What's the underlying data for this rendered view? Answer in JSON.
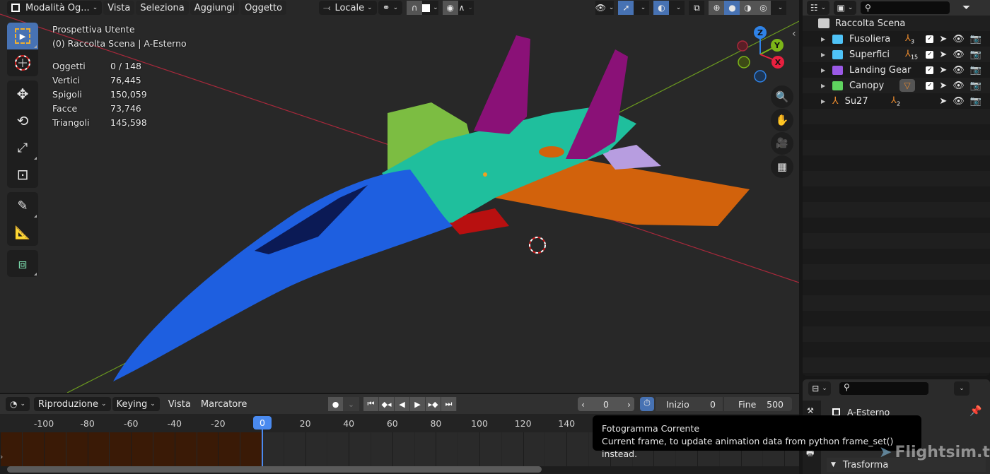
{
  "viewport_header": {
    "mode_label": "Modalità Og...",
    "menus": [
      "Vista",
      "Seleziona",
      "Aggiungi",
      "Oggetto"
    ],
    "transform_orientation": "Locale"
  },
  "overlay": {
    "view_name": "Prospettiva Utente",
    "context": "(0) Raccolta Scena | A-Esterno",
    "stats": [
      {
        "label": "Oggetti",
        "value": "0 / 148"
      },
      {
        "label": "Vertici",
        "value": "76,445"
      },
      {
        "label": "Spigoli",
        "value": "150,059"
      },
      {
        "label": "Facce",
        "value": "73,746"
      },
      {
        "label": "Triangoli",
        "value": "145,598"
      }
    ]
  },
  "gizmo": {
    "x": "X",
    "y": "Y",
    "z": "Z"
  },
  "outliner": {
    "root": "Raccolta Scena",
    "items": [
      {
        "name": "Fusoliera",
        "color": "#4fc3f7",
        "badge": "3",
        "checkbox": true
      },
      {
        "name": "Superfici",
        "color": "#4fc3f7",
        "badge": "15",
        "checkbox": true
      },
      {
        "name": "Landing Gear",
        "color": "#9b59e6",
        "badge": "",
        "checkbox": true
      },
      {
        "name": "Canopy",
        "color": "#5fd35f",
        "badge": "",
        "checkbox": true
      },
      {
        "name": "Su27",
        "color": "#e8892d",
        "badge": "2",
        "checkbox": false
      }
    ]
  },
  "properties": {
    "object_name": "A-Esterno",
    "panel": "Trasforma"
  },
  "timeline": {
    "menus": [
      "Riproduzione",
      "Keying",
      "Vista",
      "Marcatore"
    ],
    "current_frame": "0",
    "start_label": "Inizio",
    "start_value": "0",
    "end_label": "Fine",
    "end_value": "500",
    "ticks": [
      "-100",
      "-80",
      "-60",
      "-40",
      "-20",
      "0",
      "20",
      "40",
      "60",
      "80",
      "100",
      "120",
      "140"
    ],
    "playhead_label": "0"
  },
  "tooltip": {
    "title": "Fotogramma Corrente",
    "body": "Current frame, to update animation data from python frame_set() instead."
  },
  "watermark": "Flightsim.to"
}
